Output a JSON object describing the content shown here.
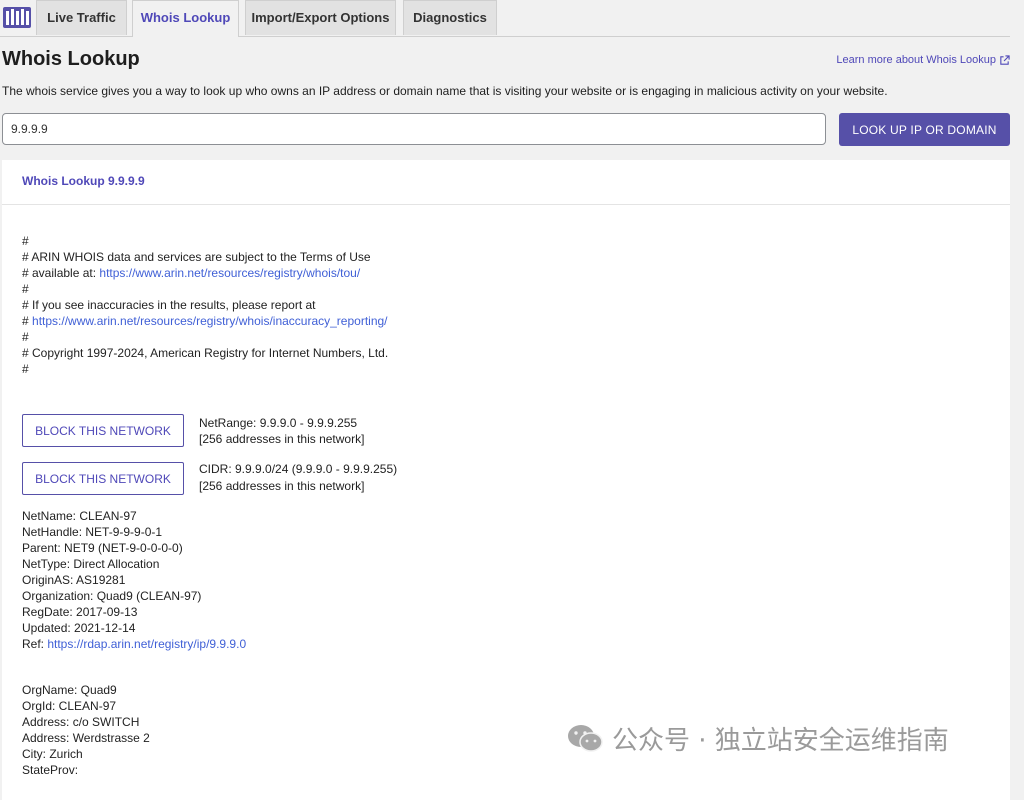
{
  "tabs": [
    {
      "label": "Live Traffic"
    },
    {
      "label": "Whois Lookup"
    },
    {
      "label": "Import/Export Options"
    },
    {
      "label": "Diagnostics"
    }
  ],
  "active_tab": "Whois Lookup",
  "page": {
    "title": "Whois Lookup",
    "learn_more": "Learn more about Whois Lookup",
    "description": "The whois service gives you a way to look up who owns an IP address or domain name that is visiting your website or is engaging in malicious activity on your website."
  },
  "search": {
    "value": "9.9.9.9",
    "button": "LOOK UP IP OR DOMAIN"
  },
  "results": {
    "heading": "Whois Lookup 9.9.9.9",
    "comments": [
      {
        "text": "#"
      },
      {
        "text": "# ARIN WHOIS data and services are subject to the Terms of Use"
      },
      {
        "text": "# available at: ",
        "link": "https://www.arin.net/resources/registry/whois/tou/"
      },
      {
        "text": "#"
      },
      {
        "text": "# If you see inaccuracies in the results, please report at"
      },
      {
        "text": "# ",
        "link": "https://www.arin.net/resources/registry/whois/inaccuracy_reporting/"
      },
      {
        "text": "#"
      },
      {
        "text": "# Copyright 1997-2024, American Registry for Internet Numbers, Ltd."
      },
      {
        "text": "#"
      }
    ],
    "block_button": "BLOCK THIS NETWORK",
    "networks": [
      {
        "line1": "NetRange: 9.9.9.0 - 9.9.9.255",
        "line2": "[256 addresses in this network]"
      },
      {
        "line1": "CIDR: 9.9.9.0/24 (9.9.9.0 - 9.9.9.255)",
        "line2": "[256 addresses in this network]"
      }
    ],
    "net_info": [
      {
        "text": "NetName: CLEAN-97"
      },
      {
        "text": "NetHandle: NET-9-9-9-0-1"
      },
      {
        "text": "Parent: NET9 (NET-9-0-0-0-0)"
      },
      {
        "text": "NetType: Direct Allocation"
      },
      {
        "text": "OriginAS: AS19281"
      },
      {
        "text": "Organization: Quad9 (CLEAN-97)"
      },
      {
        "text": "RegDate: 2017-09-13"
      },
      {
        "text": "Updated: 2021-12-14"
      },
      {
        "text": "Ref: ",
        "link": "https://rdap.arin.net/registry/ip/9.9.9.0"
      }
    ],
    "org_info": [
      {
        "text": "OrgName: Quad9"
      },
      {
        "text": "OrgId: CLEAN-97"
      },
      {
        "text": "Address: c/o SWITCH"
      },
      {
        "text": "Address: Werdstrasse 2"
      },
      {
        "text": "City: Zurich"
      },
      {
        "text": "StateProv:"
      }
    ]
  },
  "watermark": "公众号 · 独立站安全运维指南",
  "colors": {
    "accent": "#5650a8",
    "link": "#3f5fd6",
    "tab_active_text": "#4f48b8"
  }
}
